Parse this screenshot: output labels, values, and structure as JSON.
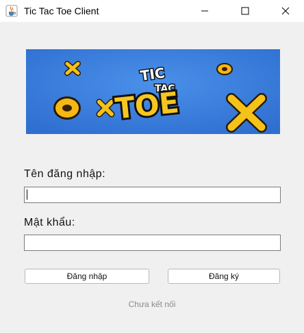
{
  "window": {
    "title": "Tic Tac Toe Client",
    "icon": "java-cup-icon"
  },
  "banner": {
    "logo_words": [
      "TIC",
      "TAC",
      "TOE"
    ],
    "background_color": "#3a7ee0"
  },
  "form": {
    "username_label": "Tên đăng nhập:",
    "username_value": "",
    "password_label": "Mật khẩu:",
    "password_value": ""
  },
  "buttons": {
    "login_label": "Đăng nhập",
    "register_label": "Đăng ký"
  },
  "status": {
    "text": "Chưa kết nối"
  }
}
